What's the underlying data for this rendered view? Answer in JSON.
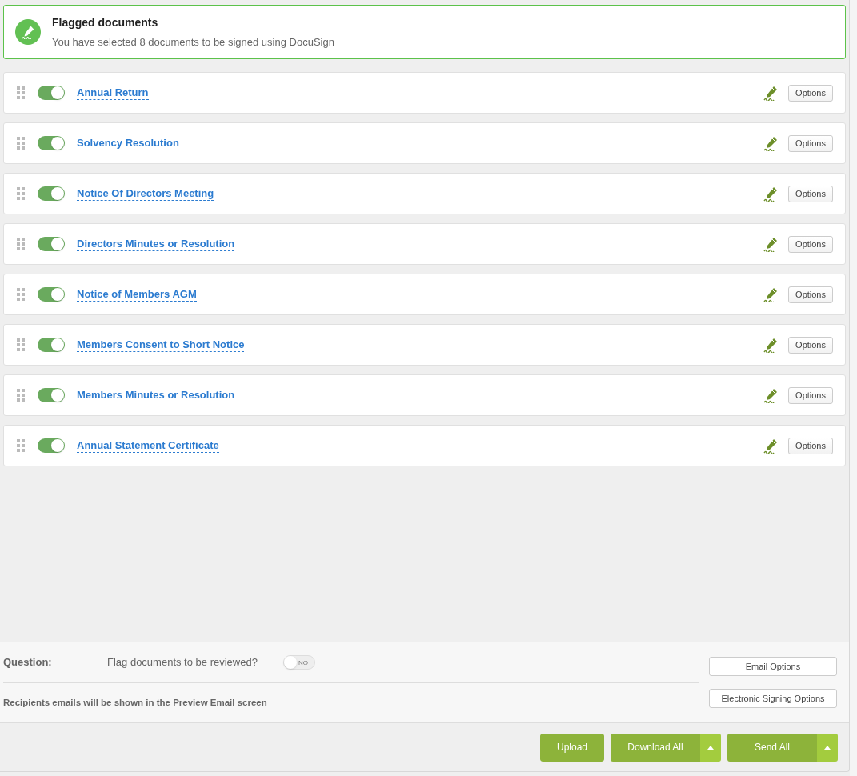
{
  "banner": {
    "title": "Flagged documents",
    "message": "You have selected 8 documents to be signed using DocuSign"
  },
  "documents": [
    {
      "title": "Annual Return",
      "on": true,
      "options": "Options"
    },
    {
      "title": "Solvency Resolution",
      "on": true,
      "options": "Options"
    },
    {
      "title": "Notice Of Directors Meeting",
      "on": true,
      "options": "Options"
    },
    {
      "title": "Directors Minutes or Resolution",
      "on": true,
      "options": "Options"
    },
    {
      "title": "Notice of Members AGM",
      "on": true,
      "options": "Options"
    },
    {
      "title": "Members Consent to Short Notice",
      "on": true,
      "options": "Options"
    },
    {
      "title": "Members Minutes or Resolution",
      "on": true,
      "options": "Options"
    },
    {
      "title": "Annual Statement Certificate",
      "on": true,
      "options": "Options"
    }
  ],
  "question": {
    "label": "Question:",
    "text": "Flag documents to be reviewed?",
    "toggle": {
      "on": false,
      "label": "NO"
    }
  },
  "note": "Recipients emails will be shown in the Preview Email screen",
  "side_buttons": [
    "Email Options",
    "Electronic Signing Options"
  ],
  "actions": [
    {
      "label": "Upload",
      "dropdown": false
    },
    {
      "label": "Download All",
      "dropdown": true
    },
    {
      "label": "Send All",
      "dropdown": true
    }
  ]
}
